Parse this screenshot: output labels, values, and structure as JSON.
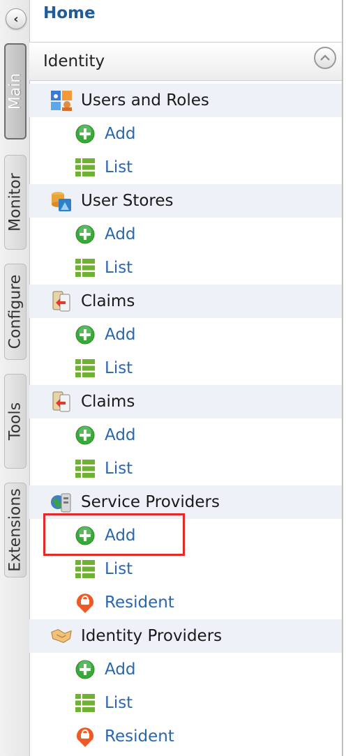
{
  "rail": {
    "collapse_glyph": "<",
    "tabs": [
      {
        "label": "Main",
        "active": true
      },
      {
        "label": "Monitor",
        "active": false
      },
      {
        "label": "Configure",
        "active": false
      },
      {
        "label": "Tools",
        "active": false
      },
      {
        "label": "Extensions",
        "active": false
      }
    ]
  },
  "home": "Home",
  "identity": {
    "label": "Identity",
    "toggle_glyph": "^"
  },
  "menu": [
    {
      "type": "section",
      "label": "Users and Roles",
      "icon": "users-roles-icon"
    },
    {
      "type": "sub",
      "label": "Add",
      "icon": "add-icon"
    },
    {
      "type": "sub",
      "label": "List",
      "icon": "list-icon"
    },
    {
      "type": "section",
      "label": "User Stores",
      "icon": "user-stores-icon"
    },
    {
      "type": "sub",
      "label": "Add",
      "icon": "add-icon"
    },
    {
      "type": "sub",
      "label": "List",
      "icon": "list-icon"
    },
    {
      "type": "section",
      "label": "Claims",
      "icon": "claims-icon"
    },
    {
      "type": "sub",
      "label": "Add",
      "icon": "add-icon"
    },
    {
      "type": "sub",
      "label": "List",
      "icon": "list-icon"
    },
    {
      "type": "section",
      "label": "Claims",
      "icon": "claims-icon"
    },
    {
      "type": "sub",
      "label": "Add",
      "icon": "add-icon"
    },
    {
      "type": "sub",
      "label": "List",
      "icon": "list-icon"
    },
    {
      "type": "section",
      "label": "Service Providers",
      "icon": "service-providers-icon"
    },
    {
      "type": "sub",
      "label": "Add",
      "icon": "add-icon",
      "highlighted": true
    },
    {
      "type": "sub",
      "label": "List",
      "icon": "list-icon"
    },
    {
      "type": "sub",
      "label": "Resident",
      "icon": "resident-icon"
    },
    {
      "type": "section",
      "label": "Identity Providers",
      "icon": "identity-providers-icon"
    },
    {
      "type": "sub",
      "label": "Add",
      "icon": "add-icon"
    },
    {
      "type": "sub",
      "label": "List",
      "icon": "list-icon"
    },
    {
      "type": "sub",
      "label": "Resident",
      "icon": "resident-icon"
    }
  ],
  "colors": {
    "link": "#2a66b0",
    "home": "#1f5c99",
    "highlight": "#e22a27",
    "section_bg": "#eef1f7"
  }
}
